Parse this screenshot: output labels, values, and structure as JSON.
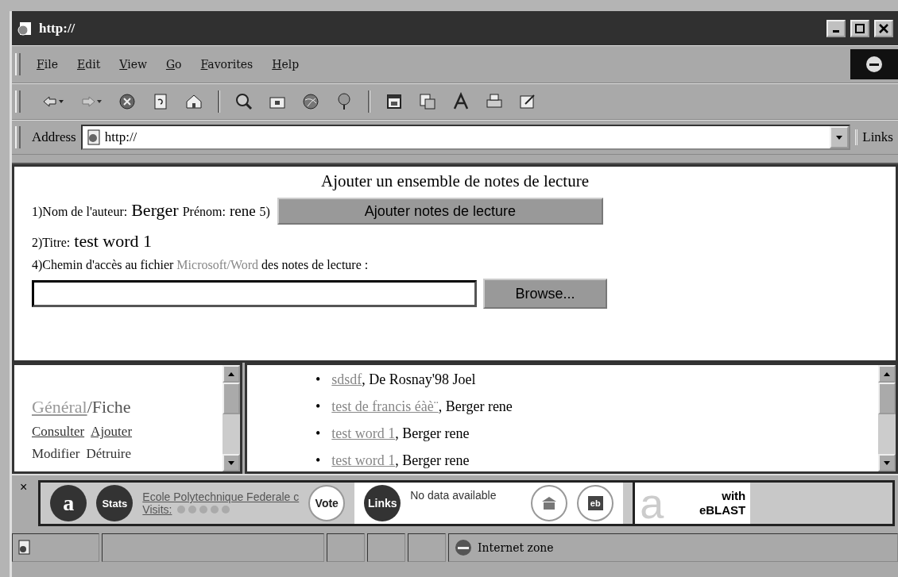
{
  "window": {
    "title": "http://"
  },
  "menu": [
    {
      "label": "File"
    },
    {
      "label": "Edit"
    },
    {
      "label": "View"
    },
    {
      "label": "Go"
    },
    {
      "label": "Favorites"
    },
    {
      "label": "Help"
    }
  ],
  "address_bar": {
    "label": "Address",
    "value": "http://",
    "links_label": "Links"
  },
  "form": {
    "heading": "Ajouter un ensemble de notes de lecture",
    "author_label": "1)Nom de l'auteur:",
    "author_value": "Berger",
    "firstname_label": "Prénom:",
    "firstname_value": "rene",
    "step5_label": "5)",
    "submit_button": "Ajouter notes de lecture",
    "title_label": "2)Titre:",
    "title_value": "test word 1",
    "path_label": [
      {
        "text": "4)Chemin d'accès au fichier ",
        "kind": "plain"
      },
      {
        "text": "Microsoft/Word",
        "kind": "muted"
      },
      {
        "text": " des notes de lecture :",
        "kind": "plain"
      }
    ],
    "browse_button": "Browse..."
  },
  "nav_frame": {
    "section_link": "Général",
    "section_rest": "/Fiche",
    "actions": [
      {
        "label": "Consulter",
        "link": true
      },
      {
        "label": "Ajouter",
        "link": true
      },
      {
        "label": "Modifier",
        "link": false
      },
      {
        "label": "Détruire",
        "link": false
      }
    ]
  },
  "list_frame": {
    "items": [
      {
        "marker": "•",
        "title": "sdsdf",
        "author": ", De Rosnay'98 Joel"
      },
      {
        "marker": "•",
        "title": "test de francis éàè¨",
        "author": ", Berger rene"
      },
      {
        "marker": "•",
        "title": "test word 1",
        "author": ", Berger rene"
      },
      {
        "marker": "•",
        "title": "test word 1",
        "author": ", Berger rene"
      }
    ]
  },
  "alexa_bar": {
    "close": "×",
    "logo": "a",
    "stats": "Stats",
    "site": "Ecole Polytechnique Federale c",
    "visits": "Visits:",
    "vote": "Vote",
    "links": "Links",
    "info": "No data available",
    "eb": "eb",
    "brand_letter": "a",
    "brand_line1": "with",
    "brand_line2": "eBLAST"
  },
  "status_bar": {
    "zone": "Internet zone"
  }
}
